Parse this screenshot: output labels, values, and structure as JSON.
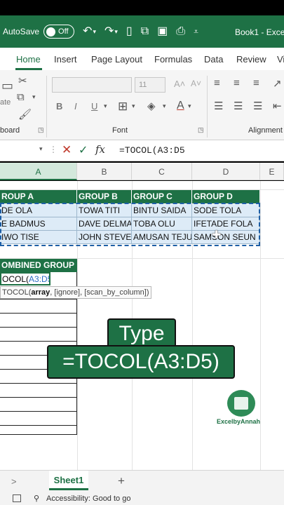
{
  "titlebar": {
    "autosave_label": "AutoSave",
    "autosave_state": "Off",
    "book_title": "Book1 - Exce"
  },
  "ribbon_tabs": [
    "Home",
    "Insert",
    "Page Layout",
    "Formulas",
    "Data",
    "Review",
    "Vi"
  ],
  "ribbon": {
    "clipboard_label": "board",
    "paste_partial": "ate",
    "font_size": "11",
    "font_label": "Font",
    "alignment_label": "Alignment"
  },
  "formula_bar": {
    "formula": "=TOCOL(A3:D5"
  },
  "columns": [
    "A",
    "B",
    "C",
    "D",
    "E"
  ],
  "table": {
    "headers": [
      "GROUP A",
      "GROUP B",
      "GROUP C",
      "GROUP D"
    ],
    "headers_visible": [
      "ROUP A",
      "GROUP B",
      "GROUP C",
      "GROUP D"
    ],
    "rows": [
      [
        "DE OLA",
        "TOWA TITI",
        "BINTU SAIDA",
        "SODE TOLA"
      ],
      [
        "E BADMUS",
        "DAVE DELMA",
        "TOBA OLU",
        "IFETADE FOLA"
      ],
      [
        "IWO TISE",
        "JOHN STEVE",
        "AMUSAN TEJU",
        "SAMSON SEUN"
      ]
    ]
  },
  "combined": {
    "header": "OMBINED GROUP",
    "cell_prefix": "OCOL(",
    "cell_ref": "A3:D5",
    "tooltip_fn": "TOCOL(",
    "tooltip_arg1": "array",
    "tooltip_rest": ", [ignore], [scan_by_column])"
  },
  "caption": {
    "line1": "Type",
    "line2": "=TOCOL(A3:D5)"
  },
  "watermark": "ExcelbyAnnah",
  "sheet_tabs": {
    "nav": ">",
    "sheet1": "Sheet1",
    "add": "+"
  },
  "status": {
    "accessibility": "Accessibility: Good to go"
  },
  "colors": {
    "excel_green": "#1e7145",
    "data_fill": "#ddebf7",
    "selection_blue": "#1e5fa6"
  }
}
